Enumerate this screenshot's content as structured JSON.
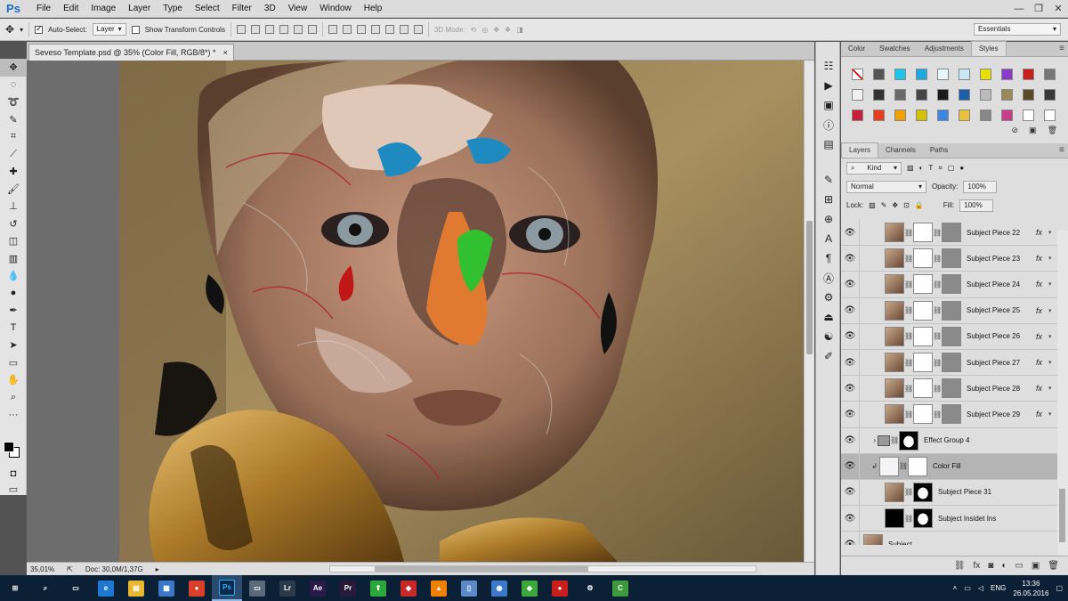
{
  "app": {
    "logo": "Ps"
  },
  "menu": [
    "File",
    "Edit",
    "Image",
    "Layer",
    "Type",
    "Select",
    "Filter",
    "3D",
    "View",
    "Window",
    "Help"
  ],
  "window_controls": [
    "—",
    "❐",
    "✕"
  ],
  "options": {
    "auto_select_label": "Auto-Select:",
    "auto_select_target": "Layer",
    "show_transform_label": "Show Transform Controls",
    "mode_3d_label": "3D Mode:",
    "workspace": "Essentials"
  },
  "document": {
    "tab_title": "Seveso Template.psd @ 35% (Color Fill, RGB/8*) *",
    "close": "×"
  },
  "status": {
    "zoom": "35,01%",
    "doc_size": "Doc: 30,0M/1,37G"
  },
  "panels": {
    "top_tabs": [
      "Color",
      "Swatches",
      "Adjustments",
      "Styles"
    ],
    "top_active": "Styles",
    "styles_swatches": [
      "#ffffff",
      "#555555",
      "#1ec6e8",
      "#1ea8e0",
      "#e8f6fb",
      "#c8e8f8",
      "#e8e000",
      "#8a3cc8",
      "#c81e1e",
      "#777777",
      "#f0f0f0",
      "#333333",
      "#6a6a6a",
      "#444444",
      "#1a1a1a",
      "#1a5ea8",
      "#bbbbbb",
      "#9a8a5a",
      "#5a4a2a",
      "#3a3a3a",
      "#c81e3c",
      "#e83c1e",
      "#f0a000",
      "#d4c000",
      "#3c88e0",
      "#e8c03c",
      "#888888",
      "#c83c8a",
      "#ffffff",
      "#ffffff"
    ],
    "layers_tabs": [
      "Layers",
      "Channels",
      "Paths"
    ],
    "layers_active": "Layers",
    "kind_filter": "Kind",
    "blend_mode": "Normal",
    "opacity_label": "Opacity:",
    "opacity": "100%",
    "lock_label": "Lock:",
    "fill_label": "Fill:",
    "fill": "100%"
  },
  "layers": [
    {
      "name": "Subject Piece 22",
      "fx": "fx",
      "mask": "gray"
    },
    {
      "name": "Subject Piece 23",
      "fx": "fx",
      "mask": "gray"
    },
    {
      "name": "Subject Piece 24",
      "fx": "fx",
      "mask": "gray"
    },
    {
      "name": "Subject Piece 25",
      "fx": "fx",
      "mask": "gray"
    },
    {
      "name": "Subject Piece 26",
      "fx": "fx",
      "mask": "gray"
    },
    {
      "name": "Subject Piece 27",
      "fx": "fx",
      "mask": "gray"
    },
    {
      "name": "Subject Piece 28",
      "fx": "fx",
      "mask": "gray"
    },
    {
      "name": "Subject Piece 29",
      "fx": "fx",
      "mask": "gray"
    },
    {
      "name": "Effect Group 4",
      "fx": "",
      "mask": "black"
    },
    {
      "name": "Color Fill",
      "fx": "",
      "mask": "white"
    },
    {
      "name": "Subject Piece 31",
      "fx": "",
      "mask": "black"
    },
    {
      "name": "Subject Insidet Ins",
      "fx": "",
      "mask": "black"
    },
    {
      "name": "Subject",
      "fx": "",
      "mask": "none"
    }
  ],
  "taskbar": {
    "apps": [
      {
        "icon": "windows-start-icon",
        "label": "⊞",
        "color": "#0b1f35"
      },
      {
        "icon": "search-icon",
        "label": "⌕",
        "color": "#0b1f35"
      },
      {
        "icon": "task-view-icon",
        "label": "▭",
        "color": "#0b1f35"
      },
      {
        "icon": "edge-icon",
        "label": "e",
        "color": "#1e78d2"
      },
      {
        "icon": "explorer-icon",
        "label": "▤",
        "color": "#e8b830"
      },
      {
        "icon": "store-icon",
        "label": "▦",
        "color": "#3c78c8"
      },
      {
        "icon": "chrome-icon",
        "label": "●",
        "color": "#d8402a"
      },
      {
        "icon": "photoshop-icon",
        "label": "Ps",
        "color": "#0a2a4a"
      },
      {
        "icon": "monitor-icon",
        "label": "▭",
        "color": "#5a6a7a"
      },
      {
        "icon": "lightroom-icon",
        "label": "Lr",
        "color": "#2a3a4a"
      },
      {
        "icon": "after-effects-icon",
        "label": "Ae",
        "color": "#2a1a4a"
      },
      {
        "icon": "premiere-icon",
        "label": "Pr",
        "color": "#2a1a3a"
      },
      {
        "icon": "upload-arrow-icon",
        "label": "⬆",
        "color": "#2aa83c"
      },
      {
        "icon": "app-red-icon",
        "label": "◆",
        "color": "#c82a2a"
      },
      {
        "icon": "vlc-icon",
        "label": "▲",
        "color": "#f08000"
      },
      {
        "icon": "document-icon",
        "label": "▯",
        "color": "#5a8ac8"
      },
      {
        "icon": "network-icon",
        "label": "◉",
        "color": "#3a7ac8"
      },
      {
        "icon": "green-app-icon",
        "label": "◈",
        "color": "#3ca83c"
      },
      {
        "icon": "record-icon",
        "label": "●",
        "color": "#c81e1e"
      },
      {
        "icon": "settings-gear-icon",
        "label": "⚙",
        "color": "#0b1f35"
      },
      {
        "icon": "camtasia-icon",
        "label": "C",
        "color": "#3c9a3c"
      }
    ],
    "tray": {
      "lang": "ENG",
      "time": "13:36",
      "date": "26.05.2016"
    }
  }
}
